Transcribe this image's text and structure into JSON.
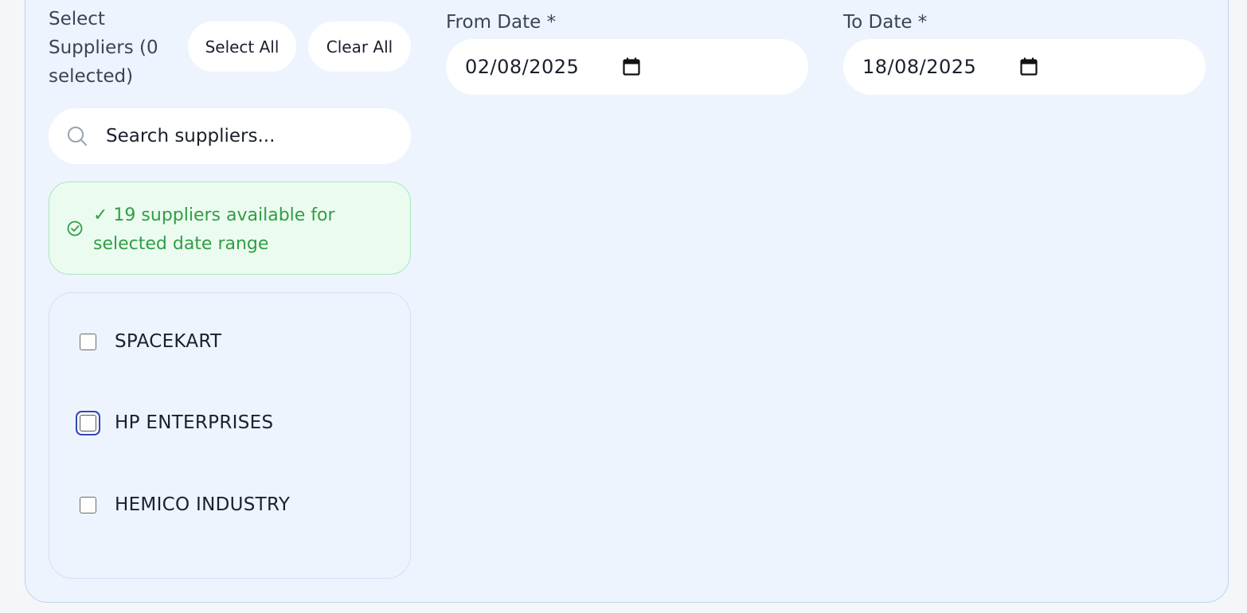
{
  "suppliers": {
    "title": "Select Suppliers (0 selected)",
    "select_all_label": "Select All",
    "clear_all_label": "Clear All",
    "search_placeholder": "Search suppliers...",
    "status_text": "✓ 19 suppliers available for selected date range",
    "items": [
      {
        "label": "SPACEKART",
        "checked": false
      },
      {
        "label": "HP ENTERPRISES",
        "checked": false,
        "focused": true
      },
      {
        "label": "HEMICO INDUSTRY",
        "checked": false
      }
    ]
  },
  "from_date": {
    "label": "From Date *",
    "value": "02/08/2025"
  },
  "to_date": {
    "label": "To Date *",
    "value": "18/08/2025"
  },
  "colors": {
    "panel_bg": "#edf4fe",
    "success_text": "#2f9e44",
    "success_bg": "#ecfbf0",
    "focus_ring": "#2e47b8"
  }
}
